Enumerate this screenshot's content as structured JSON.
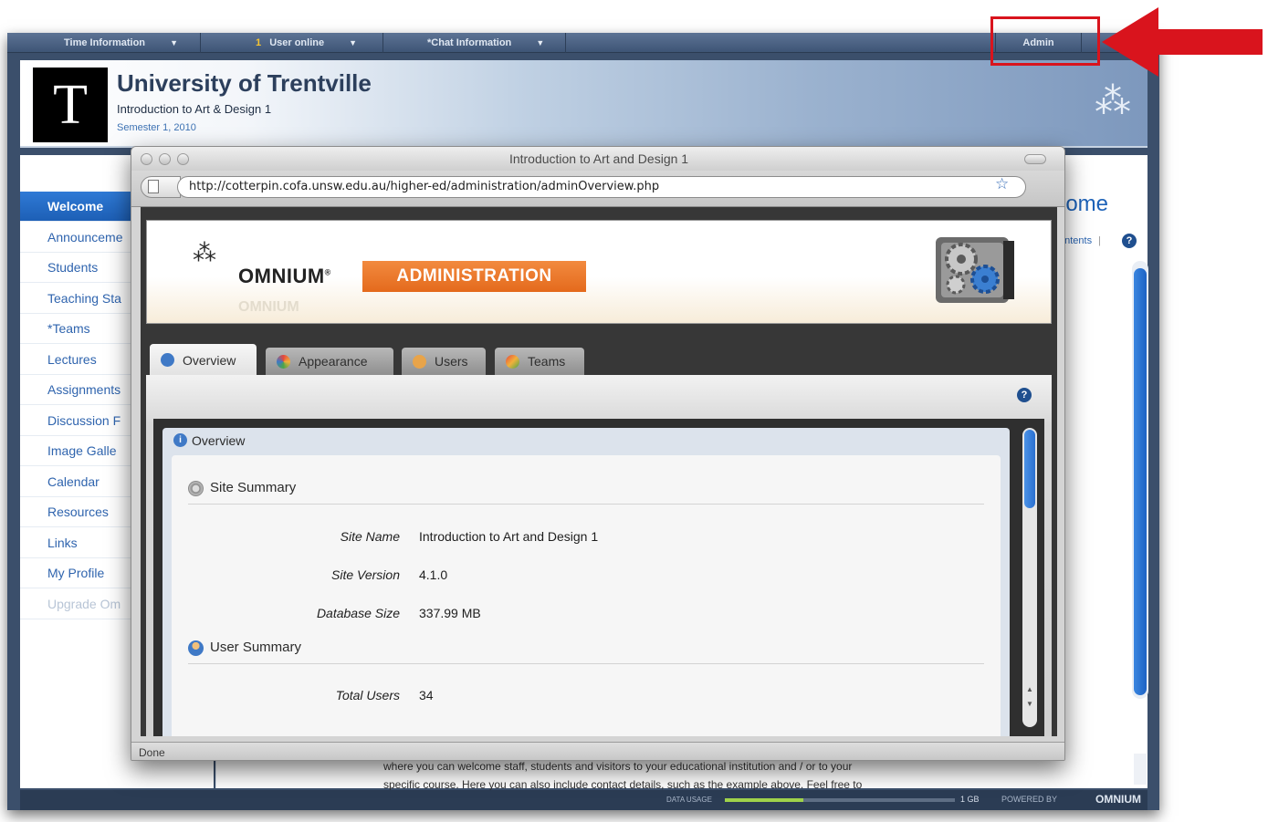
{
  "topbar": {
    "time_info": "Time Information",
    "users_count": "1",
    "users_label": "User online",
    "chat_info": "*Chat Information",
    "admin": "Admin",
    "dropdown_glyph": "▼"
  },
  "header": {
    "logo_letter": "T",
    "title": "University of Trentville",
    "course": "Introduction to Art & Design 1",
    "semester": "Semester 1, 2010"
  },
  "sidebar": {
    "items": [
      {
        "label": "Welcome"
      },
      {
        "label": "Announceme"
      },
      {
        "label": "Students"
      },
      {
        "label": "Teaching Sta"
      },
      {
        "label": "*Teams"
      },
      {
        "label": "Lectures"
      },
      {
        "label": "Assignments"
      },
      {
        "label": "Discussion F"
      },
      {
        "label": "Image Galle"
      },
      {
        "label": "Calendar"
      },
      {
        "label": "Resources"
      },
      {
        "label": "Links"
      },
      {
        "label": "My Profile"
      },
      {
        "label": "Upgrade Om"
      }
    ]
  },
  "main": {
    "welcome_heading": "lcome",
    "contents_link": "ontents",
    "separator": "|",
    "help": "?",
    "body_text_line1": "where you can welcome staff, students and visitors to your educational institution and / or to your",
    "body_text_line2": "specific course. Here you can also include contact details, such as the example above. Feel free to"
  },
  "footer": {
    "data_usage": "DATA USAGE",
    "data_usage_fraction": 0.34,
    "capacity": "1 GB",
    "powered_by": "POWERED BY",
    "brand": "OMNIUM"
  },
  "browser": {
    "window_title": "Introduction to Art and Design 1",
    "url": "http://cotterpin.cofa.unsw.edu.au/higher-ed/administration/adminOverview.php",
    "bookmark_glyph": "☆",
    "status": "Done"
  },
  "admin_page": {
    "brand": "OMNIUM",
    "brand_mark": "®",
    "brand_glyph": "⁂",
    "brand_ghost": "OMNIUM",
    "section_tag": "ADMINISTRATION",
    "help": "?",
    "tabs": [
      {
        "label": "Overview",
        "active": true,
        "icon": "info-icon"
      },
      {
        "label": "Appearance",
        "active": false,
        "icon": "palette-icon"
      },
      {
        "label": "Users",
        "active": false,
        "icon": "user-icon"
      },
      {
        "label": "Teams",
        "active": false,
        "icon": "team-icon"
      }
    ],
    "overview_title": "Overview",
    "site_summary": {
      "title": "Site Summary",
      "rows": [
        {
          "label": "Site Name",
          "value": "Introduction to Art and Design 1"
        },
        {
          "label": "Site Version",
          "value": "4.1.0"
        },
        {
          "label": "Database Size",
          "value": "337.99 MB"
        }
      ]
    },
    "user_summary": {
      "title": "User Summary",
      "rows": [
        {
          "label": "Total Users",
          "value": "34"
        }
      ]
    }
  },
  "colors": {
    "highlight_box": "#d9141d",
    "accent_blue": "#1d62b8",
    "admin_orange": "#e46a1c"
  }
}
